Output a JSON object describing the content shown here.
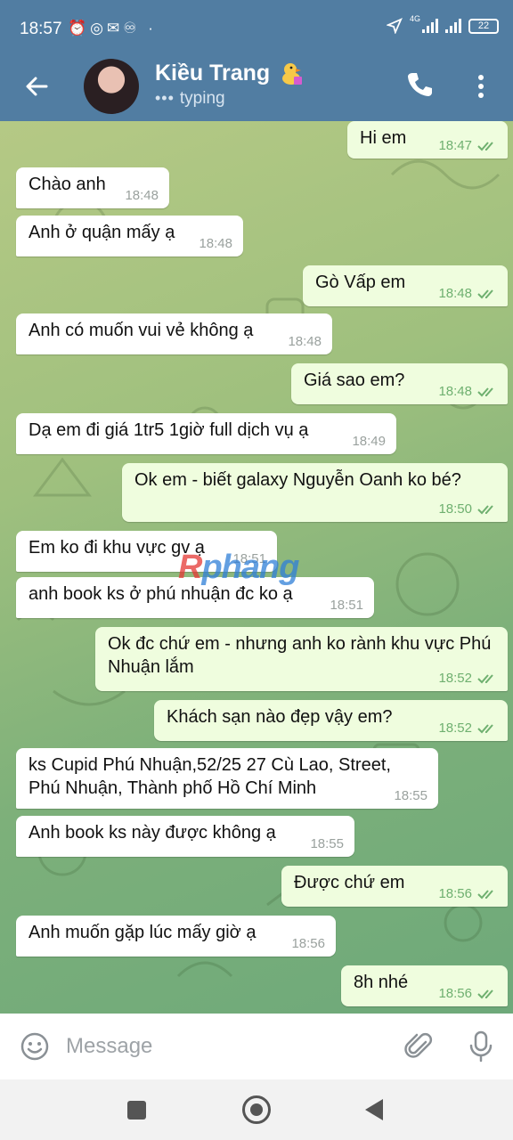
{
  "status_bar": {
    "time": "18:57",
    "network": "4G",
    "battery": "22"
  },
  "header": {
    "contact_name": "Kiều Trang",
    "status": "typing"
  },
  "messages": [
    {
      "dir": "out",
      "text": "Hi em",
      "time": "18:47"
    },
    {
      "dir": "in",
      "text": "Chào anh",
      "time": "18:48"
    },
    {
      "dir": "in",
      "text": "Anh ở quận mấy ạ",
      "time": "18:48"
    },
    {
      "dir": "out",
      "text": "Gò Vấp em",
      "time": "18:48"
    },
    {
      "dir": "in",
      "text": "Anh có muốn vui vẻ không ạ",
      "time": "18:48"
    },
    {
      "dir": "out",
      "text": "Giá sao em?",
      "time": "18:48"
    },
    {
      "dir": "in",
      "text": "Dạ em đi giá 1tr5 1giờ full dịch vụ ạ",
      "time": "18:49"
    },
    {
      "dir": "out",
      "text": "Ok em - biết galaxy Nguyễn Oanh ko bé?",
      "time": "18:50"
    },
    {
      "dir": "in",
      "text": "Em ko đi khu vực gv ạ",
      "time": "18:51"
    },
    {
      "dir": "in",
      "text": "anh book ks ở phú nhuận đc ko ạ",
      "time": "18:51"
    },
    {
      "dir": "out",
      "text": "Ok đc chứ em - nhưng anh ko rành khu vực Phú Nhuận lắm",
      "time": "18:52"
    },
    {
      "dir": "out",
      "text": "Khách sạn nào đẹp vậy em?",
      "time": "18:52"
    },
    {
      "dir": "in",
      "text": "ks Cupid Phú Nhuận,52/25 27 Cù Lao, Street, Phú Nhuận, Thành phố Hồ Chí Minh",
      "time": "18:55"
    },
    {
      "dir": "in",
      "text": "Anh book ks này được không ạ",
      "time": "18:55"
    },
    {
      "dir": "out",
      "text": "Được chứ em",
      "time": "18:56"
    },
    {
      "dir": "in",
      "text": "Anh muốn gặp lúc mấy giờ ạ",
      "time": "18:56"
    },
    {
      "dir": "out",
      "text": "8h nhé",
      "time": "18:56"
    }
  ],
  "watermark": {
    "prefix": "R",
    "rest": "phang"
  },
  "composer": {
    "placeholder": "Message"
  },
  "colors": {
    "header": "#517da2",
    "outgoing_bubble": "#effdde",
    "incoming_bubble": "#ffffff",
    "read_check": "#6fb070"
  },
  "icons": [
    "back-arrow-icon",
    "phone-icon",
    "more-vert-icon",
    "emoji-icon",
    "attach-icon",
    "mic-icon",
    "double-check-icon"
  ]
}
